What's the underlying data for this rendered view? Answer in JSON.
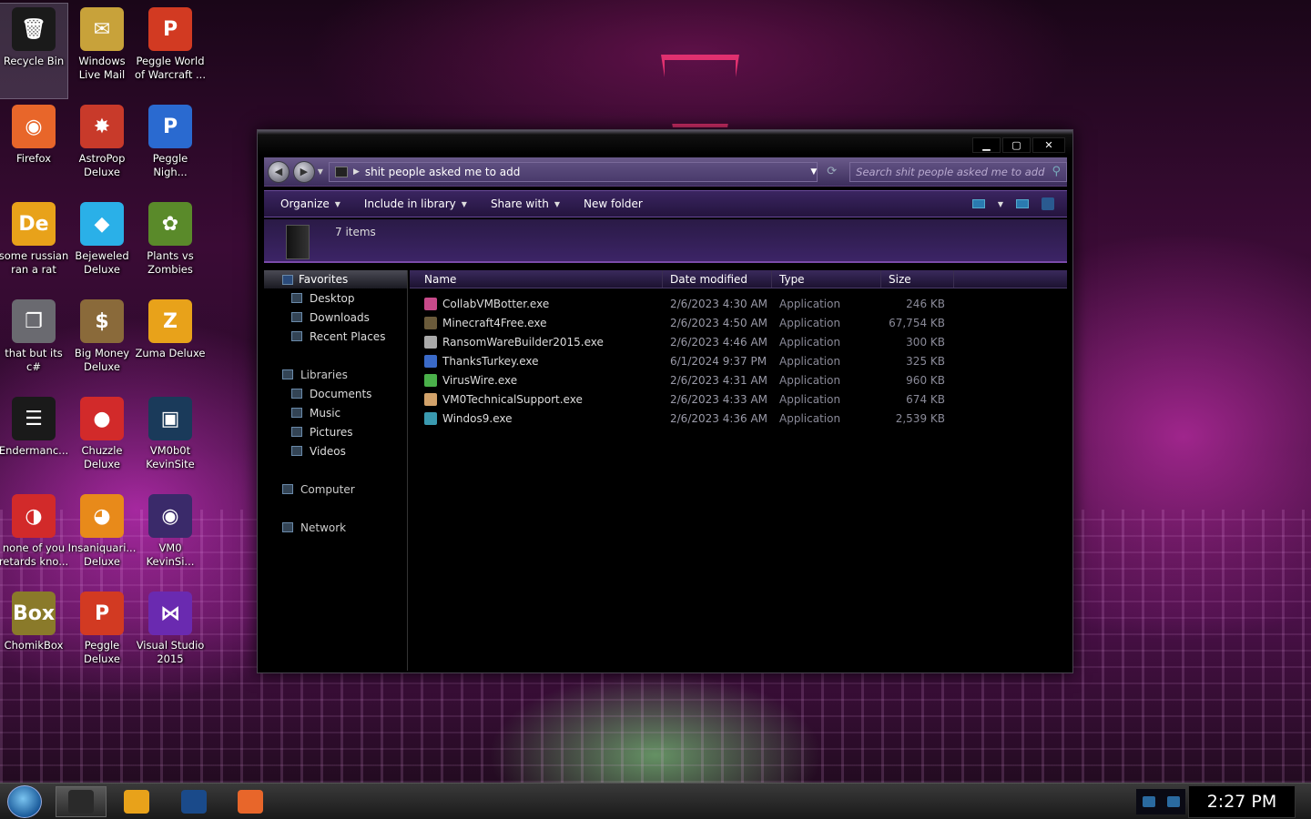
{
  "desktop": {
    "icons": [
      {
        "label": "Recycle Bin",
        "icon": "recycle-bin-icon",
        "color": "#1a1a1a",
        "glyph": "🗑"
      },
      {
        "label": "Windows Live Mail",
        "icon": "mail-icon",
        "color": "#c8a23a",
        "glyph": "✉"
      },
      {
        "label": "Peggle World of Warcraft ...",
        "icon": "peggle-icon",
        "color": "#d23a22",
        "glyph": "P"
      },
      {
        "label": "Firefox",
        "icon": "firefox-icon",
        "color": "#e8662a",
        "glyph": "◉"
      },
      {
        "label": "AstroPop Deluxe",
        "icon": "astropop-icon",
        "color": "#c83a2a",
        "glyph": "✸"
      },
      {
        "label": "Peggle Nigh...",
        "icon": "peggle-nights-icon",
        "color": "#2a6ad0",
        "glyph": "P"
      },
      {
        "label": "some russian ran a rat",
        "icon": "de-icon",
        "color": "#e8a21a",
        "glyph": "De"
      },
      {
        "label": "Bejeweled Deluxe",
        "icon": "gem-icon",
        "color": "#2ab0e8",
        "glyph": "◆"
      },
      {
        "label": "Plants vs Zombies",
        "icon": "plant-icon",
        "color": "#5a8a2a",
        "glyph": "✿"
      },
      {
        "label": "that but its c#",
        "icon": "copy-window-icon",
        "color": "#6a6a70",
        "glyph": "❐"
      },
      {
        "label": "Big Money Deluxe",
        "icon": "money-bag-icon",
        "color": "#8a6a3a",
        "glyph": "$"
      },
      {
        "label": "Zuma Deluxe",
        "icon": "zuma-icon",
        "color": "#e8a21a",
        "glyph": "Z"
      },
      {
        "label": "Endermanc...",
        "icon": "console-icon",
        "color": "#1a1a1a",
        "glyph": "☰"
      },
      {
        "label": "Chuzzle Deluxe",
        "icon": "chuzzle-icon",
        "color": "#d22a2a",
        "glyph": "●"
      },
      {
        "label": "VM0b0t KevinSite",
        "icon": "vm-icon",
        "color": "#1a3a5a",
        "glyph": "▣"
      },
      {
        "label": "none of you retards kno...",
        "icon": "bird-icon",
        "color": "#d22a2a",
        "glyph": "◑"
      },
      {
        "label": "Insaniquari... Deluxe",
        "icon": "fish-icon",
        "color": "#e88a1a",
        "glyph": "◕"
      },
      {
        "label": "VM0 KevinSi...",
        "icon": "firefox-shortcut-icon",
        "color": "#3a2a6a",
        "glyph": "◉"
      },
      {
        "label": "ChomikBox",
        "icon": "chomikbox-icon",
        "color": "#8a7a2a",
        "glyph": "Box"
      },
      {
        "label": "Peggle Deluxe",
        "icon": "peggle-deluxe-icon",
        "color": "#d23a22",
        "glyph": "P"
      },
      {
        "label": "Visual Studio 2015",
        "icon": "visual-studio-icon",
        "color": "#6a2ab0",
        "glyph": "⋈"
      }
    ]
  },
  "window": {
    "buttons": {
      "minimize": "▁",
      "maximize": "▢",
      "close": "✕"
    },
    "address_path": "shit people asked me to add",
    "search_placeholder": "Search shit people asked me to add",
    "toolbar": {
      "organize": "Organize",
      "include": "Include in library",
      "share": "Share with",
      "new_folder": "New folder"
    },
    "item_count": "7 items",
    "nav": {
      "favorites": "Favorites",
      "desktop": "Desktop",
      "downloads": "Downloads",
      "recent": "Recent Places",
      "libraries": "Libraries",
      "documents": "Documents",
      "music": "Music",
      "pictures": "Pictures",
      "videos": "Videos",
      "computer": "Computer",
      "network": "Network"
    },
    "columns": {
      "name": "Name",
      "date": "Date modified",
      "type": "Type",
      "size": "Size"
    },
    "files": [
      {
        "name": "CollabVMBotter.exe",
        "date": "2/6/2023 4:30 AM",
        "type": "Application",
        "size": "246 KB",
        "color": "#c84a8a"
      },
      {
        "name": "Minecraft4Free.exe",
        "date": "2/6/2023 4:50 AM",
        "type": "Application",
        "size": "67,754 KB",
        "color": "#6a5a3a"
      },
      {
        "name": "RansomWareBuilder2015.exe",
        "date": "2/6/2023 4:46 AM",
        "type": "Application",
        "size": "300 KB",
        "color": "#aaaaaa"
      },
      {
        "name": "ThanksTurkey.exe",
        "date": "6/1/2024 9:37 PM",
        "type": "Application",
        "size": "325 KB",
        "color": "#3a6ac8"
      },
      {
        "name": "VirusWire.exe",
        "date": "2/6/2023 4:31 AM",
        "type": "Application",
        "size": "960 KB",
        "color": "#4ab04a"
      },
      {
        "name": "VM0TechnicalSupport.exe",
        "date": "2/6/2023 4:33 AM",
        "type": "Application",
        "size": "674 KB",
        "color": "#d2a26a"
      },
      {
        "name": "Windos9.exe",
        "date": "2/6/2023 4:36 AM",
        "type": "Application",
        "size": "2,539 KB",
        "color": "#3a9ab0"
      }
    ]
  },
  "taskbar": {
    "clock": "2:27 PM",
    "programs": [
      {
        "name": "explorer-taskbar-button",
        "color": "#2a2a2a"
      },
      {
        "name": "media-player-taskbar-button",
        "color": "#e8a21a"
      },
      {
        "name": "vm-taskbar-button",
        "color": "#1a4a8a"
      },
      {
        "name": "firefox-taskbar-button",
        "color": "#e8662a"
      }
    ]
  }
}
